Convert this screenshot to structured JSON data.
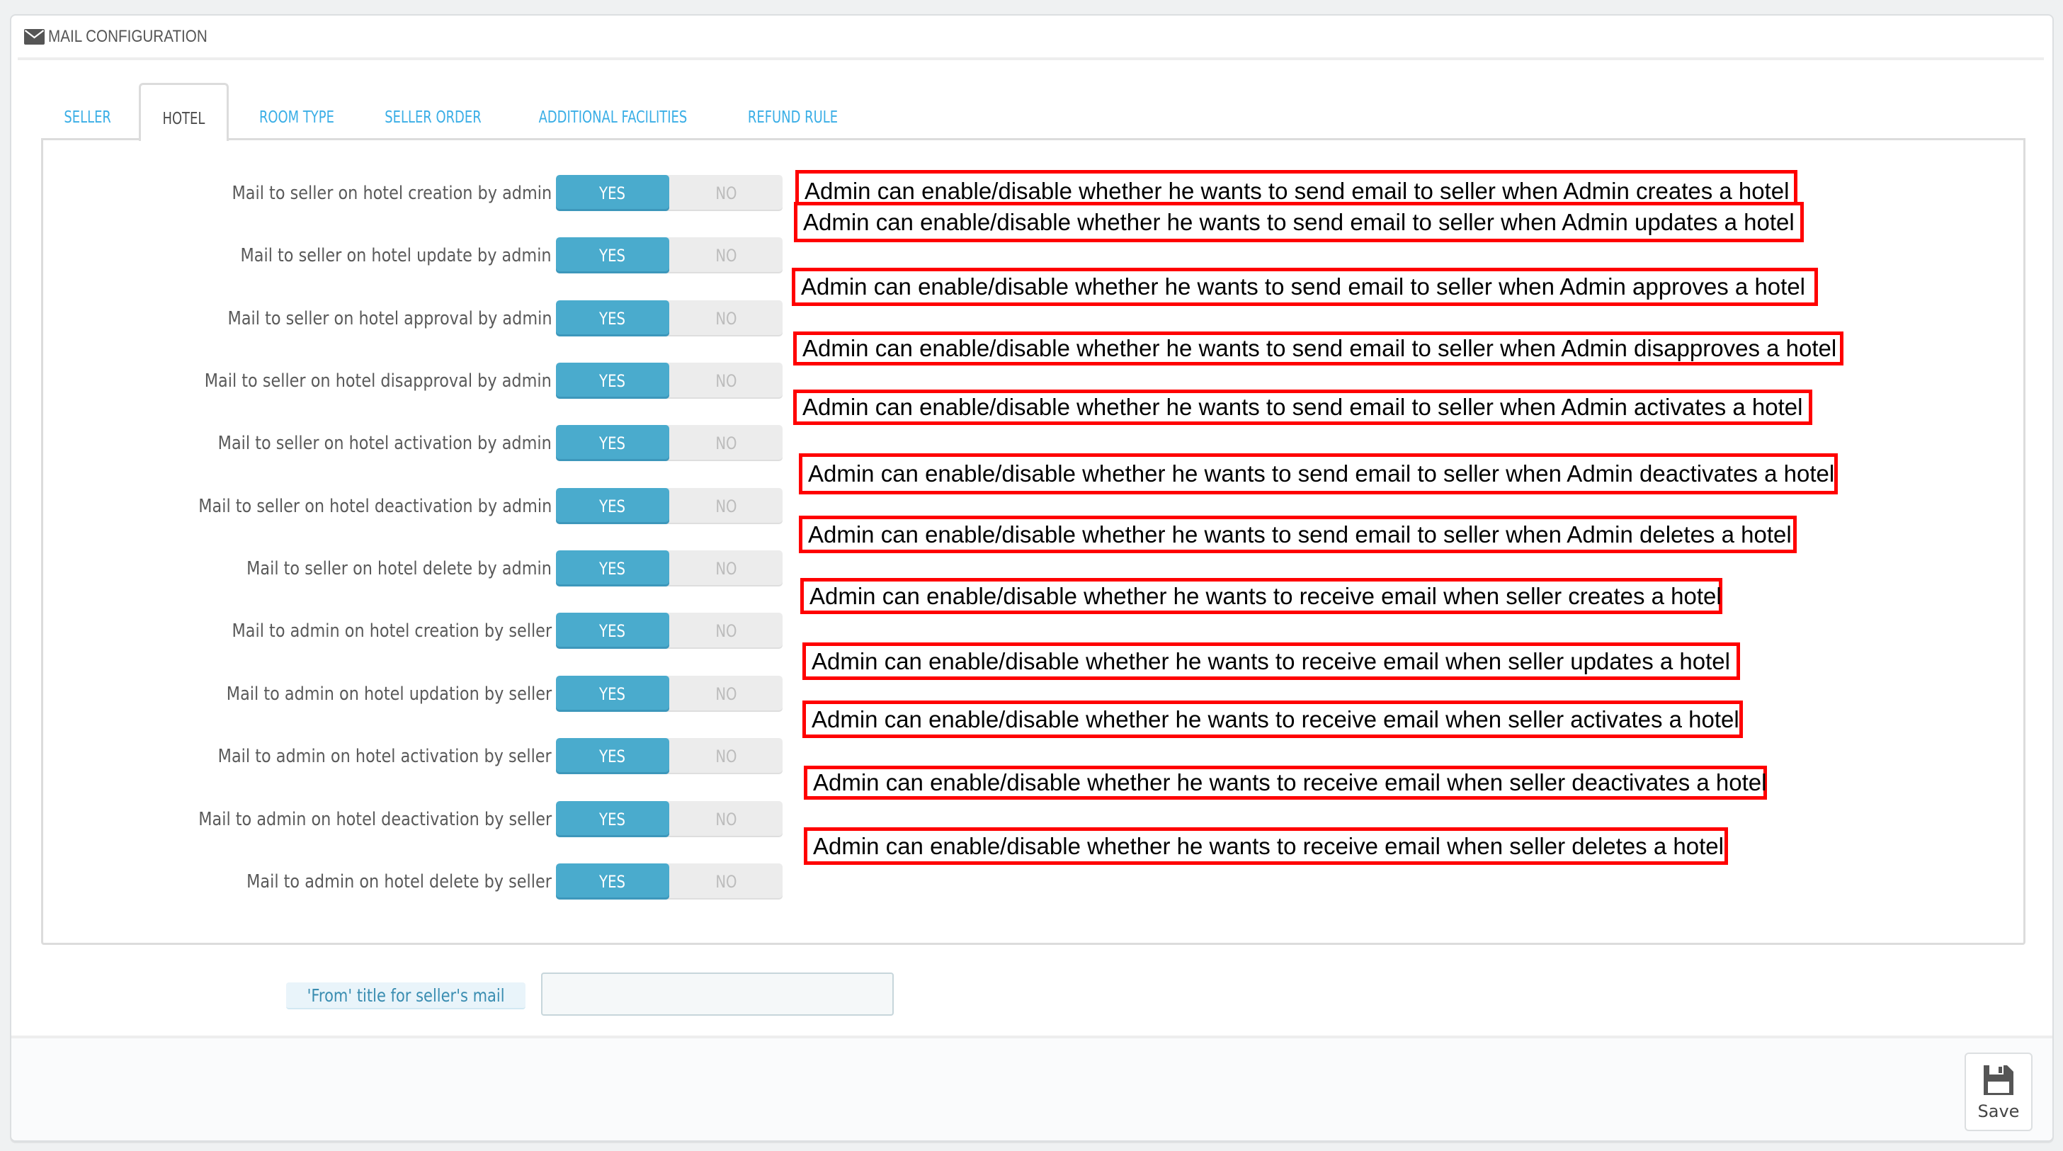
{
  "panel": {
    "title": "MAIL CONFIGURATION",
    "icon": "envelope-icon"
  },
  "tabs": [
    {
      "label": "SELLER",
      "active": false
    },
    {
      "label": "HOTEL",
      "active": true
    },
    {
      "label": "ROOM TYPE",
      "active": false
    },
    {
      "label": "SELLER ORDER",
      "active": false
    },
    {
      "label": "ADDITIONAL FACILITIES",
      "active": false
    },
    {
      "label": "REFUND RULE",
      "active": false
    }
  ],
  "toggle_options": {
    "yes": "YES",
    "no": "NO"
  },
  "colors": {
    "toggle_on": "#4aabcd",
    "tab_link": "#3aaee6",
    "annotation_border": "#ff0000"
  },
  "settings": [
    {
      "label": "Mail to seller on hotel creation by admin",
      "value": "YES",
      "annotation": "Admin can enable/disable whether he wants to send email to seller when Admin creates a hotel"
    },
    {
      "label": "Mail to seller on hotel update by admin",
      "value": "YES",
      "annotation": "Admin can enable/disable whether he wants to send email to seller when Admin updates a hotel"
    },
    {
      "label": "Mail to seller on hotel approval by admin",
      "value": "YES",
      "annotation": "Admin can enable/disable whether he wants to send email to seller when Admin approves a hotel"
    },
    {
      "label": "Mail to seller on hotel disapproval by admin",
      "value": "YES",
      "annotation": "Admin can enable/disable whether he wants to send email to seller when Admin disapproves a hotel"
    },
    {
      "label": "Mail to seller on hotel activation by admin",
      "value": "YES",
      "annotation": "Admin can enable/disable whether he wants to send email to seller when Admin activates a hotel"
    },
    {
      "label": "Mail to seller on hotel deactivation by admin",
      "value": "YES",
      "annotation": "Admin can enable/disable whether he wants to send email to seller when Admin deactivates a hotel"
    },
    {
      "label": "Mail to seller on hotel delete by admin",
      "value": "YES",
      "annotation": "Admin can enable/disable whether he wants to send email to seller when Admin deletes a hotel"
    },
    {
      "label": "Mail to admin on hotel creation by seller",
      "value": "YES",
      "annotation": "Admin can enable/disable whether he wants to receive email when seller creates a hotel"
    },
    {
      "label": "Mail to admin on hotel updation by seller",
      "value": "YES",
      "annotation": "Admin can enable/disable whether he wants to receive email when seller updates a hotel"
    },
    {
      "label": "Mail to admin on hotel activation by seller",
      "value": "YES",
      "annotation": "Admin can enable/disable whether he wants to receive email when seller activates a hotel"
    },
    {
      "label": "Mail to admin on hotel deactivation by seller",
      "value": "YES",
      "annotation": "Admin can enable/disable whether he wants to receive email when seller deactivates a hotel"
    },
    {
      "label": "Mail to admin on hotel delete by seller",
      "value": "YES",
      "annotation": "Admin can enable/disable whether he wants to receive email when seller deletes a hotel"
    }
  ],
  "from_title": {
    "label": "'From' title for seller's mail",
    "value": "",
    "placeholder": ""
  },
  "footer": {
    "save_label": "Save",
    "save_icon": "floppy-disk-icon"
  }
}
